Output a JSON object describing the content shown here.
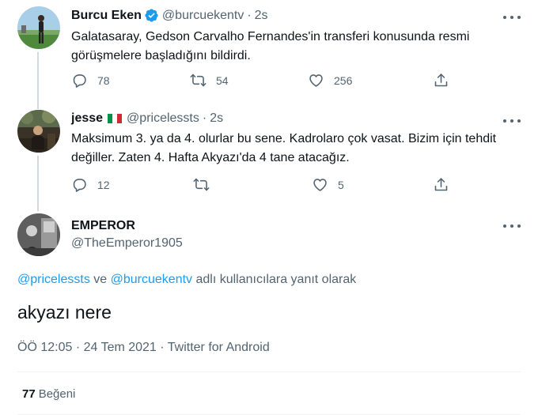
{
  "tweet1": {
    "name": "Burcu Eken",
    "handle": "@burcuekentv",
    "separator": "·",
    "time": "2s",
    "text": "Galatasaray, Gedson Carvalho Fernandes'in transferi konusunda resmi görüşmelere başladığını bildirdi.",
    "reply_count": "78",
    "retweet_count": "54",
    "like_count": "256"
  },
  "tweet2": {
    "name": "jesse",
    "handle": "@pricelessts",
    "separator": "·",
    "time": "2s",
    "text": "Maksimum 3. ya da 4. olurlar bu sene. Kadrolaro çok vasat. Bizim için tehdit değiller. Zaten 4. Hafta Akyazı'da 4 tane atacağız.",
    "reply_count": "12",
    "retweet_count": "",
    "like_count": "5"
  },
  "main": {
    "name": "EMPEROR",
    "handle": "@TheEmperor1905",
    "reply_mention1": "@pricelessts",
    "reply_and": " ve ",
    "reply_mention2": "@burcuekentv",
    "reply_suffix": " adlı kullanıcılara yanıt olarak",
    "text": "akyazı nere",
    "time": "ÖÖ 12:05",
    "separator": "·",
    "date": "24 Tem 2021",
    "source": "Twitter for Android",
    "like_count": "77",
    "like_label": "Beğeni"
  },
  "colors": {
    "accent": "#1d9bf0",
    "secondary_text": "#536471",
    "primary_text": "#0f1419",
    "flag_green": "#009246",
    "flag_red": "#ce2b37"
  },
  "icons": [
    "reply-icon",
    "retweet-icon",
    "like-icon",
    "share-icon",
    "verified-icon",
    "more-icon",
    "italy-flag-icon"
  ]
}
